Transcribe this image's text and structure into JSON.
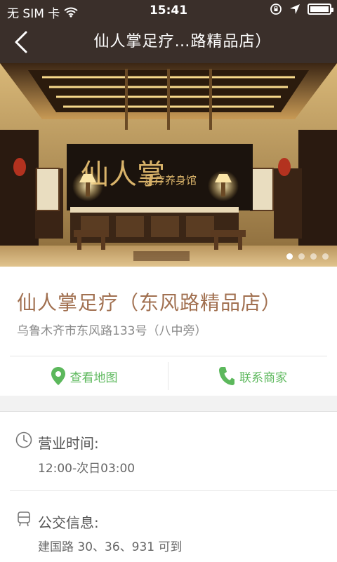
{
  "status": {
    "carrier": "无 SIM 卡",
    "time": "15:41"
  },
  "nav": {
    "title": "仙人掌足疗…路精品店）"
  },
  "hero": {
    "sign_text": "仙人掌",
    "sign_subtext": "足疗养身馆",
    "slide_count": 4,
    "active_slide": 1
  },
  "shop": {
    "name": "仙人掌足疗（东风路精品店）",
    "address": "乌鲁木齐市东风路133号（八中旁）"
  },
  "actions": {
    "map_label": "查看地图",
    "call_label": "联系商家"
  },
  "details": {
    "hours_title": "营业时间:",
    "hours_value": "12:00-次日03:00",
    "bus_title": "公交信息:",
    "bus_value": "建国路 30、36、931 可到"
  },
  "colors": {
    "nav_bg": "#3a2f2a",
    "accent_brown": "#a17050",
    "action_green": "#5cb85c"
  }
}
